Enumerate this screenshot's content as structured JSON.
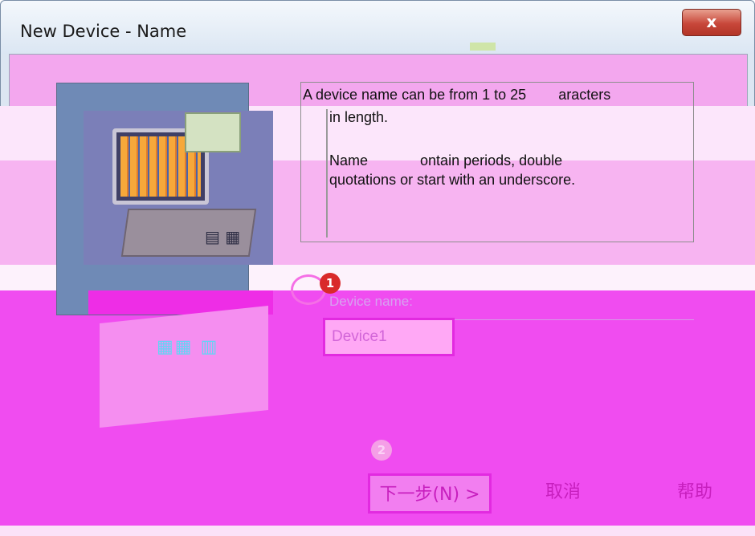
{
  "window": {
    "title": "New Device - Name",
    "close_glyph": "x"
  },
  "description": {
    "line1": "A device name can be from 1 to 25",
    "line1_tail": "aracters",
    "line2": "in length.",
    "line3": "Name",
    "line3_tail": "ontain periods, double",
    "line4": "quotations or start with an underscore."
  },
  "form": {
    "device_name_label": "Device name:",
    "device_name_value": "Device1"
  },
  "steps": {
    "step1": "1",
    "step2": "2"
  },
  "buttons": {
    "next": "下一步(N) >",
    "cancel": "取消",
    "help": "帮助"
  },
  "colors": {
    "highlight_magenta": "#f04cf0",
    "annotation_border": "#e22ae0",
    "badge_red": "#d92a2a"
  },
  "icons": {
    "illustration": "computer-illustration",
    "close": "close-icon"
  }
}
